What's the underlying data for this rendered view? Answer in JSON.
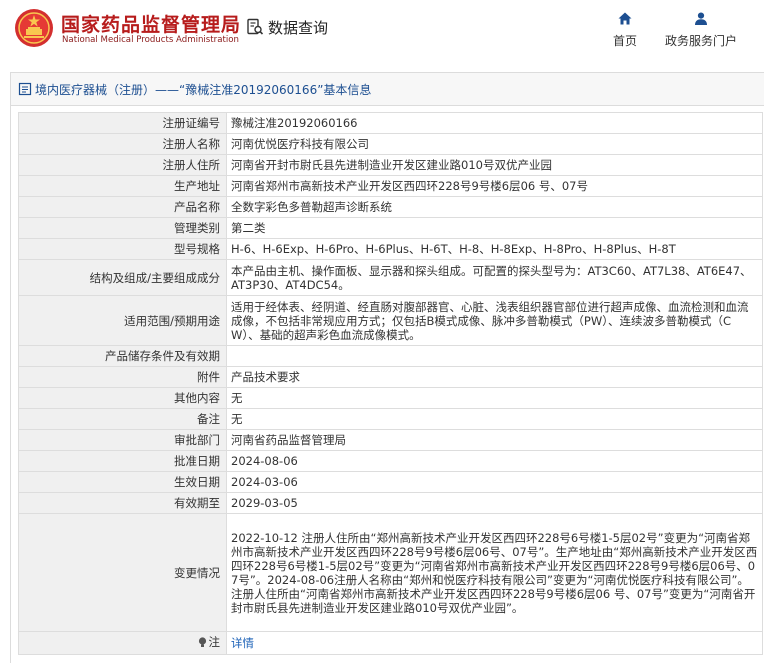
{
  "header": {
    "site_title": "国家药品监督管理局",
    "site_subtitle": "National Medical Products Administration",
    "query_label": "数据查询",
    "nav": [
      {
        "label": "首页",
        "icon": "home-icon"
      },
      {
        "label": "政务服务门户",
        "icon": "user-icon"
      }
    ]
  },
  "panel": {
    "breadcrumb": "境内医疗器械（注册）——“豫械注准20192060166”基本信息"
  },
  "rows": [
    {
      "key": "注册证编号",
      "value": "豫械注准20192060166"
    },
    {
      "key": "注册人名称",
      "value": "河南优悦医疗科技有限公司"
    },
    {
      "key": "注册人住所",
      "value": "河南省开封市尉氏县先进制造业开发区建业路010号双优产业园"
    },
    {
      "key": "生产地址",
      "value": "河南省郑州市高新技术产业开发区西四环228号9号楼6层06 号、07号"
    },
    {
      "key": "产品名称",
      "value": "全数字彩色多普勒超声诊断系统"
    },
    {
      "key": "管理类别",
      "value": "第二类"
    },
    {
      "key": "型号规格",
      "value": "H-6、H-6Exp、H-6Pro、H-6Plus、H-6T、H-8、H-8Exp、H-8Pro、H-8Plus、H-8T"
    },
    {
      "key": "结构及组成/主要组成成分",
      "value": "本产品由主机、操作面板、显示器和探头组成。可配置的探头型号为：AT3C60、AT7L38、AT6E47、AT3P30、AT4DC54。"
    },
    {
      "key": "适用范围/预期用途",
      "value": "适用于经体表、经阴道、经直肠对腹部器官、心脏、浅表组织器官部位进行超声成像、血流检测和血流成像，不包括非常规应用方式；仅包括B模式成像、脉冲多普勒模式（PW）、连续波多普勒模式（CW）、基础的超声彩色血流成像模式。"
    },
    {
      "key": "产品储存条件及有效期",
      "value": ""
    },
    {
      "key": "附件",
      "value": "产品技术要求"
    },
    {
      "key": "其他内容",
      "value": "无"
    },
    {
      "key": "备注",
      "value": "无"
    },
    {
      "key": "审批部门",
      "value": "河南省药品监督管理局"
    },
    {
      "key": "批准日期",
      "value": "2024-08-06"
    },
    {
      "key": "生效日期",
      "value": "2024-03-06"
    },
    {
      "key": "有效期至",
      "value": "2029-03-05"
    },
    {
      "key": "变更情况",
      "value": "2022-10-12 注册人住所由“郑州高新技术产业开发区西四环228号6号楼1-5层02号”变更为“河南省郑州市高新技术产业开发区西四环228号9号楼6层06号、07号”。生产地址由“郑州高新技术产业开发区西四环228号6号楼1-5层02号”变更为“河南省郑州市高新技术产业开发区西四环228号9号楼6层06号、07号”。2024-08-06注册人名称由“郑州和悦医疗科技有限公司”变更为“河南优悦医疗科技有限公司”。\n注册人住所由“河南省郑州市高新技术产业开发区西四环228号9号楼6层06 号、07号”变更为“河南省开封市尉氏县先进制造业开发区建业路010号双优产业园”。"
    }
  ],
  "note": {
    "key": "注",
    "link": "详情"
  },
  "colors": {
    "brand_red": "#b71c1c",
    "link_blue": "#1d62b7",
    "nav_blue": "#1d4f91"
  }
}
